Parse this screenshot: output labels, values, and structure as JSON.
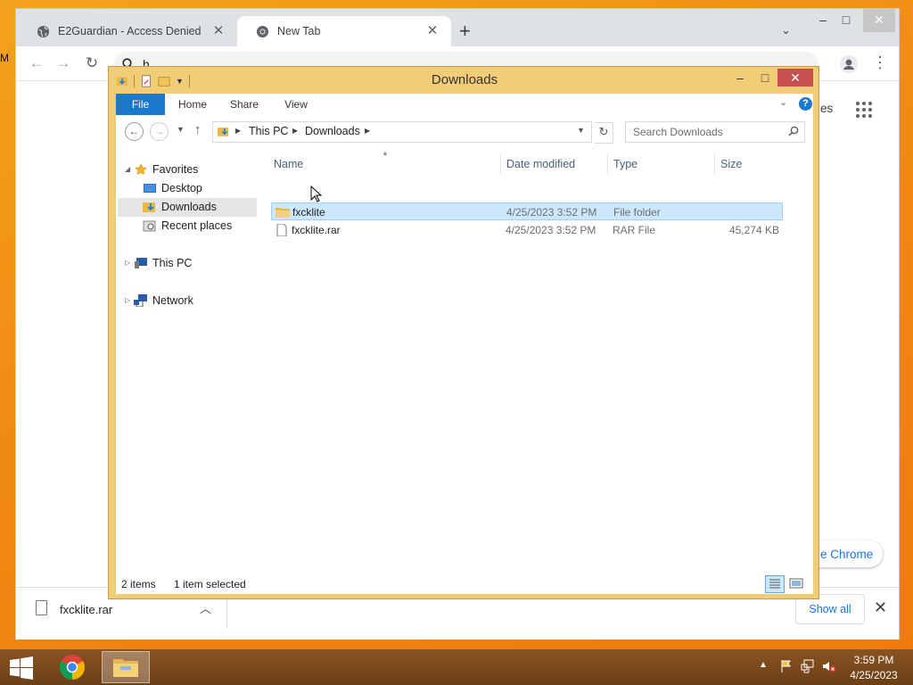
{
  "chrome": {
    "tabs": [
      {
        "label": "E2Guardian - Access Denied",
        "icon": "globe-icon"
      },
      {
        "label": "New Tab",
        "icon": "chrome-icon"
      }
    ],
    "new_tab_label": "+",
    "omnibox_text": "h",
    "partial_label_es": "es",
    "customize_label": "e Chrome",
    "download": {
      "filename": "fxcklite.rar",
      "show_all_label": "Show all"
    },
    "side_fragment": "M"
  },
  "explorer": {
    "title": "Downloads",
    "ribbon_tabs": [
      "File",
      "Home",
      "Share",
      "View"
    ],
    "breadcrumb": [
      "This PC",
      "Downloads"
    ],
    "search_placeholder": "Search Downloads",
    "nav": {
      "favorites": "Favorites",
      "desktop": "Desktop",
      "downloads": "Downloads",
      "recent": "Recent places",
      "this_pc": "This PC",
      "network": "Network"
    },
    "columns": [
      "Name",
      "Date modified",
      "Type",
      "Size"
    ],
    "files": [
      {
        "name": "fxcklite",
        "date": "4/25/2023 3:52 PM",
        "type": "File folder",
        "size": "",
        "selected": true
      },
      {
        "name": "fxcklite.rar",
        "date": "4/25/2023 3:52 PM",
        "type": "RAR File",
        "size": "45,274 KB",
        "selected": false
      }
    ],
    "status": {
      "count": "2 items",
      "selection": "1 item selected"
    }
  },
  "taskbar": {
    "time": "3:59 PM",
    "date": "4/25/2023"
  },
  "colors": {
    "accent": "#1979ca",
    "explorer_frame": "#f2cd77",
    "selection": "#cce8ff"
  }
}
